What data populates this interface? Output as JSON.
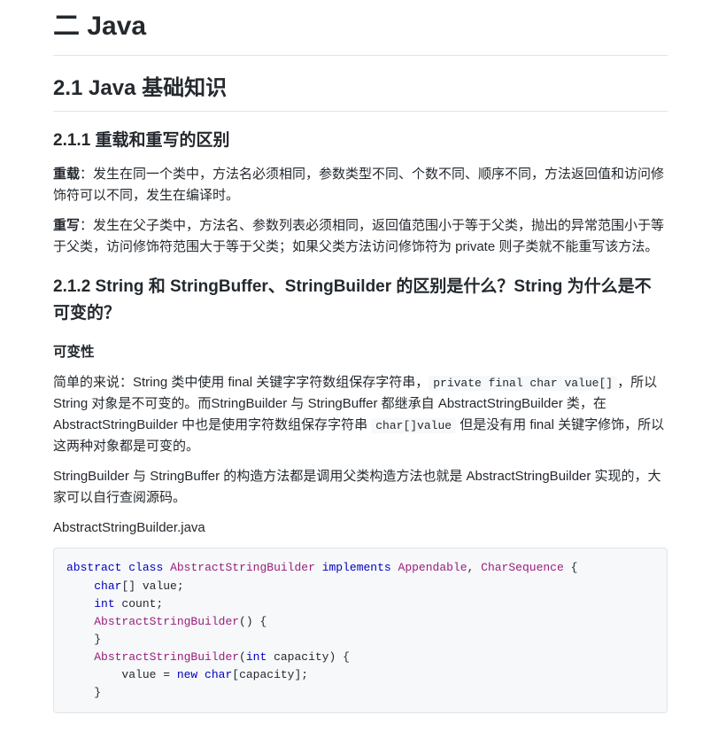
{
  "title": "二 Java",
  "section": "2.1 Java 基础知识",
  "sub1": {
    "heading": "2.1.1 重载和重写的区别",
    "p1_bold": "重载",
    "p1_rest": "：发生在同一个类中，方法名必须相同，参数类型不同、个数不同、顺序不同，方法返回值和访问修饰符可以不同，发生在编译时。",
    "p2_bold": "重写",
    "p2_rest": "：发生在父子类中，方法名、参数列表必须相同，返回值范围小于等于父类，抛出的异常范围小于等于父类，访问修饰符范围大于等于父类；如果父类方法访问修饰符为 private 则子类就不能重写该方法。"
  },
  "sub2": {
    "heading": "2.1.2 String 和 StringBuffer、StringBuilder 的区别是什么？String 为什么是不可变的？",
    "part_heading": "可变性",
    "p1_a": "简单的来说：String 类中使用 final 关键字字符数组保存字符串，",
    "p1_code": "private final char value[]",
    "p1_b": "，所以 String 对象是不可变的。而StringBuilder 与 StringBuffer 都继承自 AbstractStringBuilder 类，在 AbstractStringBuilder 中也是使用字符数组保存字符串 ",
    "p1_code2": "char[]value",
    "p1_c": " 但是没有用 final 关键字修饰，所以这两种对象都是可变的。",
    "p2": "StringBuilder 与 StringBuffer 的构造方法都是调用父类构造方法也就是 AbstractStringBuilder 实现的，大家可以自行查阅源码。",
    "p3": "AbstractStringBuilder.java"
  },
  "code": {
    "kw_abstract": "abstract",
    "kw_class": "class",
    "kw_implements": "implements",
    "kw_char": "char",
    "kw_int": "int",
    "kw_new": "new",
    "t_asb": "AbstractStringBuilder",
    "t_append": "Appendable",
    "t_charseq": "CharSequence",
    "sp1": " ",
    "sp2": " ",
    "sp3": " ",
    "sp4": " ",
    "commaSp": ", ",
    "spBraceNl": " {\n",
    "indent1_char": "    ",
    "arr_value_nl": "[] value;\n",
    "indent1_int": "    ",
    "sp_count_nl": " count;\n",
    "indent1_ctor0": "    ",
    "ctor0_tail": "() {\n    }\n",
    "indent1_ctor1": "    ",
    "ctor1_open": "(",
    "ctor1_param_tail": " capacity) {\n",
    "indent2_assign": "        value = ",
    "sp5": " ",
    "cap_tail": "[capacity];\n",
    "close_inner": "    }"
  }
}
